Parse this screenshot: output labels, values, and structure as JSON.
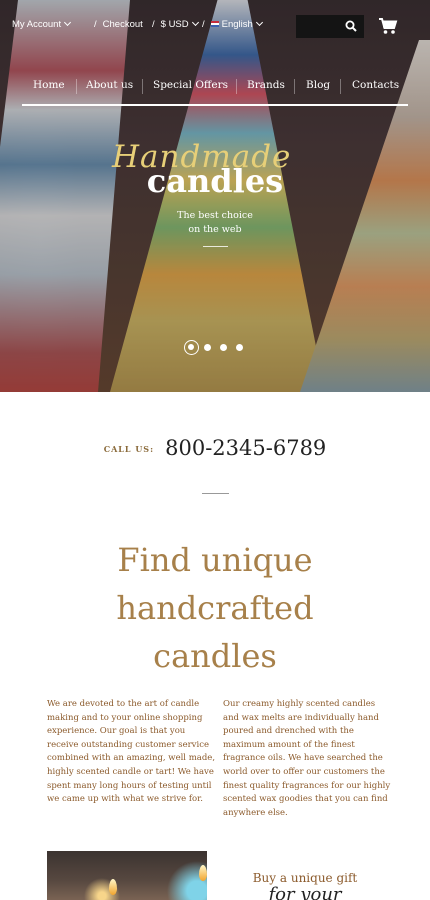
{
  "topbar": {
    "account_label": "My Account",
    "checkout_label": "Checkout",
    "currency_label": "$ USD",
    "language_label": "English",
    "separator": "/"
  },
  "nav": {
    "items": [
      "Home",
      "About us",
      "Special Offers",
      "Brands",
      "Blog",
      "Contacts"
    ]
  },
  "hero": {
    "script_title": "Handmade",
    "title": "candles",
    "tagline_line1": "The best choice",
    "tagline_line2": "on the web",
    "slide_count": 4,
    "active_slide": 1
  },
  "contact": {
    "call_label": "CALL US:",
    "phone": "800-2345-6789"
  },
  "intro": {
    "headline_line1": "Find unique",
    "headline_line2": "handcrafted",
    "headline_line3": "candles",
    "paragraph_left": "We are devoted to the art of candle making and to your online shopping experience. Our goal is that you receive outstanding customer service combined with an amazing, well made, highly scented candle or tart! We have spent many long hours of testing until we came up with what we strive for.",
    "paragraph_right": "Our creamy highly scented candles and wax melts are individually hand poured and drenched with the maximum amount of the finest fragrance oils. We have searched the world over to offer our customers the finest quality fragrances for our highly scented wax goodies that you can find anywhere else."
  },
  "promo": {
    "title": "Buy a unique gift",
    "script": "for your"
  },
  "colors": {
    "accent_gold": "#a7804a",
    "text_brown": "#8b5a2b",
    "script_gold": "#e7cf78"
  }
}
